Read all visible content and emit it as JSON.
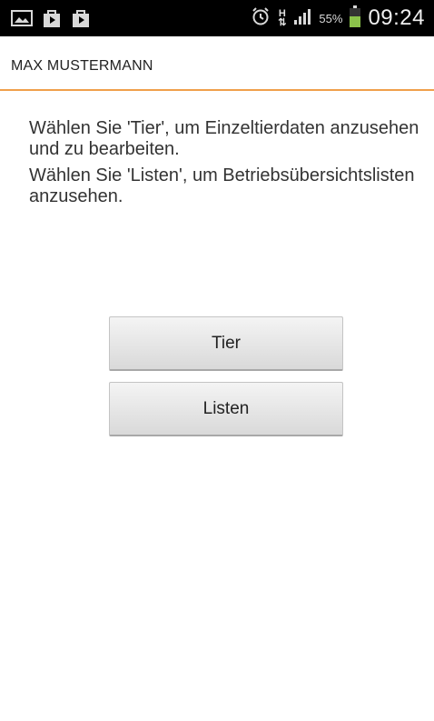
{
  "status_bar": {
    "battery_percent": "55%",
    "time": "09:24",
    "network_type": "H",
    "icons": [
      "gallery-icon",
      "shopping-bag-icon",
      "play-store-icon",
      "alarm-icon",
      "network-h-icon",
      "signal-icon",
      "battery-icon"
    ],
    "battery_color": "#8bc34a"
  },
  "action_bar": {
    "title": "MAX MUSTERMANN",
    "accent_color": "#f0a04b"
  },
  "main": {
    "instruction_1": "Wählen Sie 'Tier', um Einzeltierdaten anzusehen und zu bearbeiten.",
    "instruction_2": "Wählen Sie 'Listen', um Betriebsübersichtslisten anzusehen.",
    "buttons": {
      "tier_label": "Tier",
      "listen_label": "Listen"
    }
  }
}
